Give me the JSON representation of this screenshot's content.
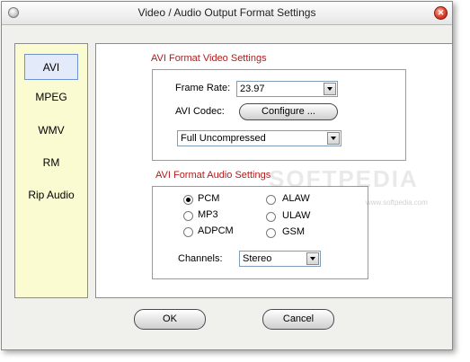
{
  "window": {
    "title": "Video / Audio Output Format Settings"
  },
  "sidebar": {
    "items": [
      "AVI",
      "MPEG",
      "WMV",
      "RM",
      "Rip Audio"
    ]
  },
  "video": {
    "section_title": "AVI Format Video Settings",
    "frame_rate_label": "Frame Rate:",
    "frame_rate_value": "23.97",
    "codec_label": "AVI Codec:",
    "configure_label": "Configure ...",
    "codec_value": "Full Uncompressed"
  },
  "audio": {
    "section_title": "AVI Format Audio Settings",
    "options": [
      "PCM",
      "ALAW",
      "MP3",
      "ULAW",
      "ADPCM",
      "GSM"
    ],
    "selected": "PCM",
    "channels_label": "Channels:",
    "channels_value": "Stereo"
  },
  "buttons": {
    "ok": "OK",
    "cancel": "Cancel"
  },
  "watermark": {
    "main": "SOFTPEDIA",
    "url": "www.softpedia.com"
  }
}
